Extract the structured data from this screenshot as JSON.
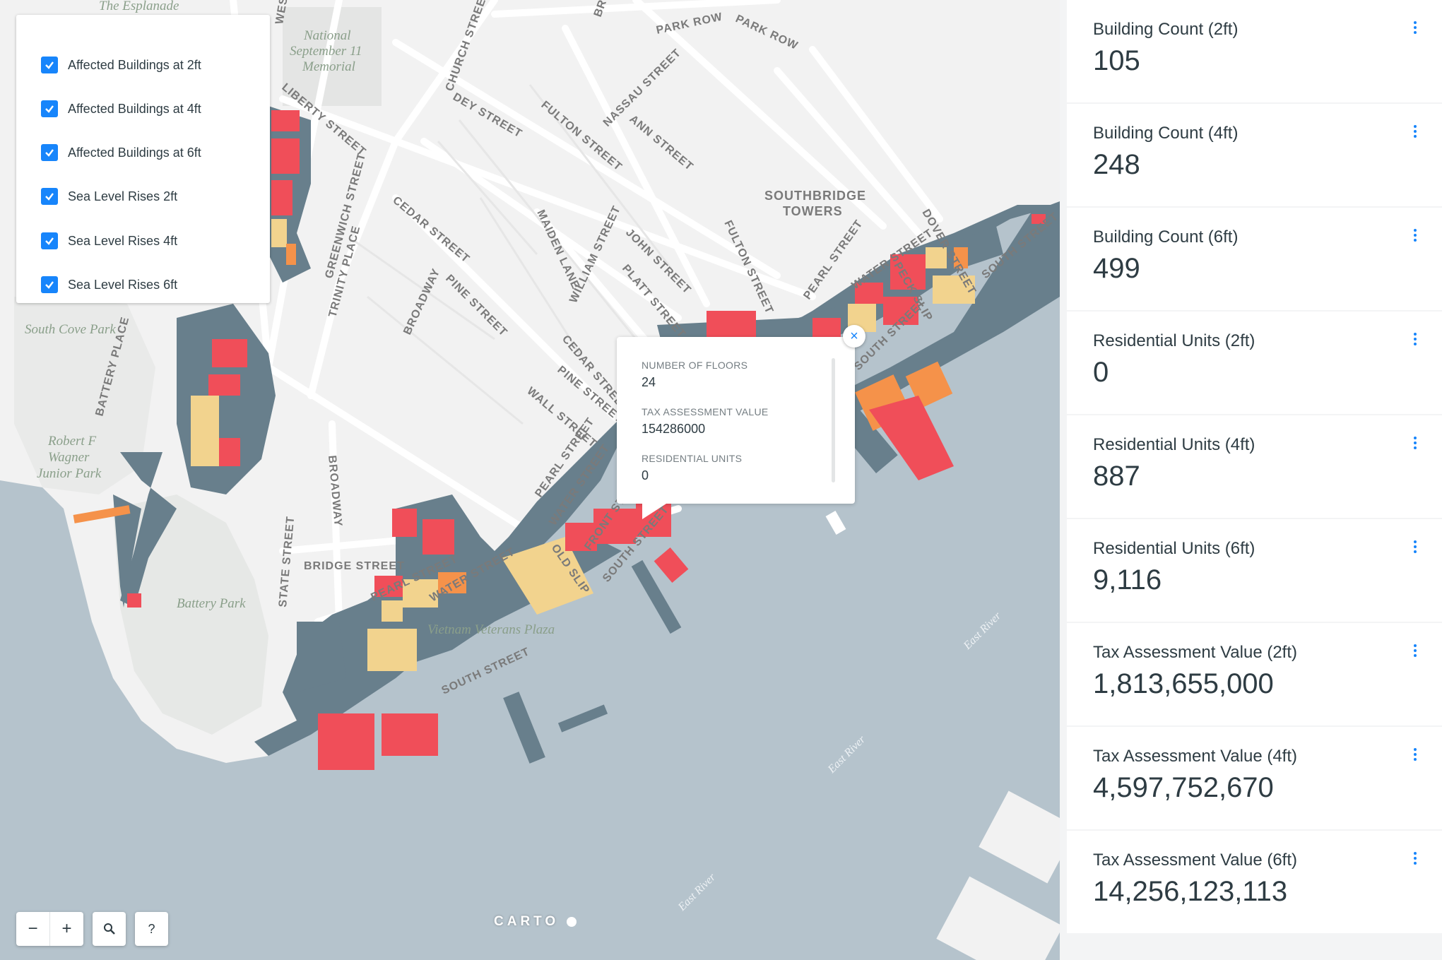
{
  "layers": {
    "items": [
      {
        "label": "Affected Buildings at 2ft",
        "checked": true
      },
      {
        "label": "Affected Buildings at 4ft",
        "checked": true
      },
      {
        "label": "Affected Buildings at 6ft",
        "checked": true
      },
      {
        "label": "Sea Level Rises 2ft",
        "checked": true
      },
      {
        "label": "Sea Level Rises 4ft",
        "checked": true
      },
      {
        "label": "Sea Level Rises 6ft",
        "checked": true
      }
    ]
  },
  "popup": {
    "fields": [
      {
        "key": "NUMBER OF FLOORS",
        "value": "24"
      },
      {
        "key": "TAX ASSESSMENT VALUE",
        "value": "154286000"
      },
      {
        "key": "RESIDENTIAL UNITS",
        "value": "0"
      }
    ],
    "close_icon": "×"
  },
  "controls": {
    "zoom_out": "−",
    "zoom_in": "+",
    "search_icon": "search-icon",
    "help": "?"
  },
  "logo": "CARTO",
  "map_labels": {
    "streets": [
      "WEST",
      "CHURCH STREET",
      "PARK ROW",
      "PARK ROW",
      "DEY STREET",
      "FULTON STREET",
      "NASSAU STREET",
      "ANN STREET",
      "LIBERTY STREET",
      "GREENWICH STREET",
      "TRINITY PLACE",
      "CEDAR STREET",
      "BROADWAY",
      "PINE STREET",
      "MAIDEN LANE",
      "WILLIAM STREET",
      "JOHN STREET",
      "PLATT STREET",
      "FULTON STREET",
      "PEARL STREET",
      "DOVER STREET",
      "WATER STREET",
      "PECK SLIP",
      "SOUTH STREET",
      "SOUTH STREET",
      "CEDAR STREET",
      "PINE STREET",
      "WALL STREET",
      "PEARL STREET",
      "WATER STREET",
      "FRONT STREET",
      "OLD SLIP",
      "SOUTH STREET",
      "BATTERY PLACE",
      "BROADWAY",
      "STATE STREET",
      "BRIDGE STREET",
      "PEARL STREET",
      "WATER STREET",
      "SOUTH STREET",
      "BRO"
    ],
    "parks": [
      "The Esplanade",
      "National September 11 Memorial",
      "South Cove Park",
      "Robert F Wagner Junior Park",
      "Battery Park",
      "Vietnam Veterans Plaza"
    ],
    "areas": [
      "SOUTHBRIDGE TOWERS"
    ],
    "water": [
      "East River",
      "East River",
      "East River"
    ]
  },
  "widgets": [
    {
      "title": "Building Count (2ft)",
      "value": "105"
    },
    {
      "title": "Building Count (4ft)",
      "value": "248"
    },
    {
      "title": "Building Count (6ft)",
      "value": "499"
    },
    {
      "title": "Residential Units (2ft)",
      "value": "0"
    },
    {
      "title": "Residential Units (4ft)",
      "value": "887"
    },
    {
      "title": "Residential Units (6ft)",
      "value": "9,116"
    },
    {
      "title": "Tax Assessment Value (2ft)",
      "value": "1,813,655,000"
    },
    {
      "title": "Tax Assessment Value (4ft)",
      "value": "4,597,752,670"
    },
    {
      "title": "Tax Assessment Value (6ft)",
      "value": "14,256,123,113"
    }
  ],
  "colors": {
    "accent": "#1785fb",
    "water": "#b5c3cc",
    "land": "#f2f2f2",
    "flood_zone": "#687f8c",
    "building_2ft": "#f04e59",
    "building_4ft": "#f5924a",
    "building_6ft": "#f2d38e"
  }
}
